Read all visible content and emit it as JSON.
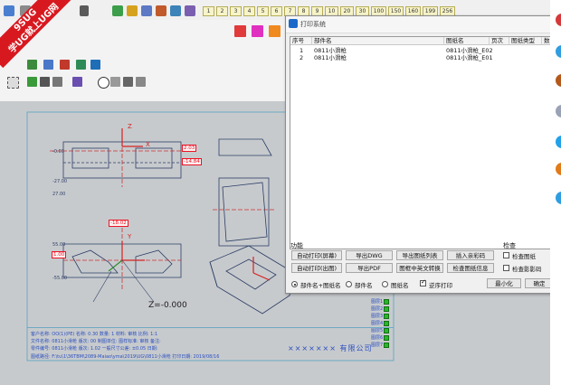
{
  "brand": {
    "line1": "9SUG",
    "line2": "学UG就上UG网"
  },
  "toolbar": {
    "number_buttons": [
      "1",
      "2",
      "3",
      "4",
      "5",
      "6",
      "7",
      "8",
      "9",
      "10",
      "20",
      "30",
      "100",
      "150",
      "160",
      "199",
      "256"
    ],
    "colors": {
      "red": "#e03a3a",
      "magenta": "#e030c0",
      "orange": "#f08a20"
    }
  },
  "dialog": {
    "title": "打印系统",
    "columns": [
      "序号",
      "部件名",
      "图纸名",
      "页次",
      "图纸类型",
      "数"
    ],
    "rows": [
      {
        "index": "1",
        "part": "0811小滑枪",
        "sheet": "0811小滑枪_E02"
      },
      {
        "index": "2",
        "part": "0811小滑枪",
        "sheet": "0811小滑枪_E01"
      }
    ],
    "function_label": "功能",
    "check_label": "检查",
    "buttons": {
      "auto_print_screen": "自动打印(屏幕)",
      "export_dwg": "导出DWG",
      "export_sheet_list": "导出图纸列表",
      "insert_sign": "插入亲彩码",
      "auto_print_plot": "自动打印(出图)",
      "export_pdf": "导出PDF",
      "sheet_cn_en": "图框中英文转换",
      "check_sheet_info": "检查图纸信息",
      "minimize": "最小化",
      "ok": "确定"
    },
    "checks": {
      "check_sheet": "检查图纸",
      "check_shadow": "检查影影码",
      "reverse_print": "逆序打印"
    },
    "radios": {
      "part_and_sheet": "部件名+图纸名",
      "part_name": "部件名",
      "sheet_name": "图纸名"
    }
  },
  "drawing": {
    "dims": {
      "d1": "2.03",
      "d2": "-14.84",
      "d3": "1.00",
      "d4": "-18.02",
      "d5": "-0.00",
      "d6": "-27.00",
      "d7": "27.00",
      "d8": "55.00",
      "d9": "-55.00"
    },
    "axis": {
      "z": "Z",
      "x": "X",
      "y": "Y"
    },
    "zero": "Z=-0.000",
    "company": "××××××× 有限公司",
    "title_rows": [
      "客户名称: OO(1)(PE)    名称: 0.30  数量: 1   材料: 审核    比例: 1:1",
      "文件名称: 0811小滑枪    版次: 00   制图单位: 图样标准: 审核  备注:",
      "零件编号: 0811小滑枪    版次: 1.02  一般尺寸公差: ±0.05 日期:",
      "图纸路径: F:\\tu\\1\\36TBM\\2089-Maiao\\yma\\2019\\UG\\0811小滑枪 打印日期: 2019/08/16"
    ],
    "layers": [
      "图层1",
      "图层2",
      "图层3",
      "图层4",
      "图层5",
      "图层6",
      "图层7"
    ]
  }
}
